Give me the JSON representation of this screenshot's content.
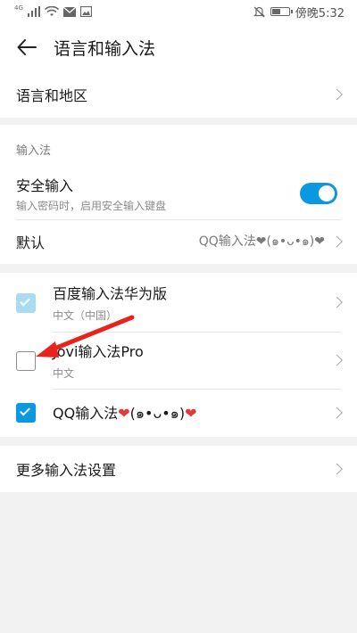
{
  "status_bar": {
    "network": "4G",
    "time": "傍晚5:32"
  },
  "header": {
    "title": "语言和输入法"
  },
  "language_region": {
    "label": "语言和地区"
  },
  "input_section": {
    "label": "输入法",
    "secure_input": {
      "title": "安全输入",
      "subtitle": "输入密码时，启用安全输入键盘",
      "enabled": true
    },
    "default": {
      "label": "默认",
      "value": "QQ输入法❤(๑•ᴗ•๑)❤"
    }
  },
  "keyboards": [
    {
      "name": "百度输入法华为版",
      "language": "中文（中国）",
      "state": "checked-disabled"
    },
    {
      "name": "Jovi输入法Pro",
      "language": "中文",
      "state": "unchecked"
    },
    {
      "name_prefix": "QQ输入法",
      "name_middle": "(๑•ᴗ•๑)",
      "state": "checked"
    }
  ],
  "more_settings": {
    "label": "更多输入法设置"
  },
  "colors": {
    "accent": "#0a98e0",
    "annotation_arrow": "#e8231c"
  },
  "icons": [
    "signal-icon",
    "wifi-icon",
    "mail-icon",
    "image-icon",
    "mute-icon",
    "battery-icon",
    "back-arrow-icon",
    "chevron-right-icon",
    "heart-icon"
  ]
}
